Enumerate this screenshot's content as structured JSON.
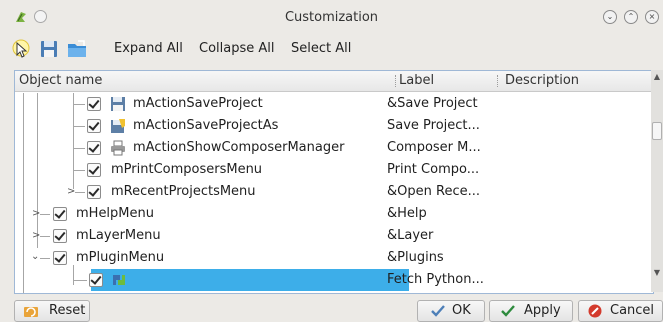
{
  "window": {
    "title": "Customization"
  },
  "toolbar": {
    "expand_all": "Expand All",
    "collapse_all": "Collapse All",
    "select_all": "Select All"
  },
  "tree": {
    "columns": [
      "Object name",
      "Label",
      "Description"
    ],
    "rows": [
      {
        "name": "mActionSaveProject",
        "label": "&Save Project",
        "icon": "save-icon",
        "checked": true
      },
      {
        "name": "mActionSaveProjectAs",
        "label": "Save Project...",
        "icon": "save-as-icon",
        "checked": true
      },
      {
        "name": "mActionShowComposerManager",
        "label": "Composer M...",
        "icon": "printer-icon",
        "checked": true
      },
      {
        "name": "mPrintComposersMenu",
        "label": "Print Compo...",
        "checked": true
      },
      {
        "name": "mRecentProjectsMenu",
        "label": "&Open Rece...",
        "checked": true
      },
      {
        "name": "mHelpMenu",
        "label": "&Help",
        "checked": true
      },
      {
        "name": "mLayerMenu",
        "label": "&Layer",
        "checked": true
      },
      {
        "name": "mPluginMenu",
        "label": "&Plugins",
        "checked": true
      },
      {
        "name": "",
        "label": "Fetch Python...",
        "icon": "python-plugin-icon",
        "checked": true,
        "selected": true
      }
    ]
  },
  "buttons": {
    "reset": "Reset",
    "ok": "OK",
    "apply": "Apply",
    "cancel": "Cancel"
  },
  "colors": {
    "selection": "#3daee9",
    "accent_border": "#9fb8d6"
  }
}
